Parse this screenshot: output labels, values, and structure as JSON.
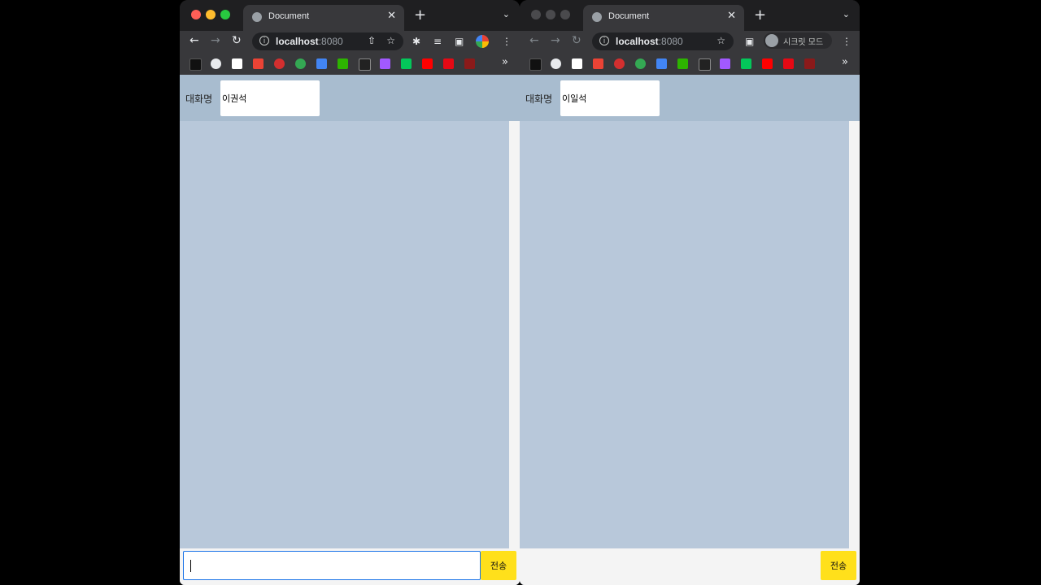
{
  "left": {
    "tab_title": "Document",
    "url_host": "localhost",
    "url_port": ":8080",
    "label": "대화명",
    "nickname": "이권석",
    "message": "",
    "send_label": "전송"
  },
  "right": {
    "tab_title": "Document",
    "url_host": "localhost",
    "url_port": ":8080",
    "incognito_label": "시크릿 모드",
    "label": "대화명",
    "nickname": "이일석",
    "message": "",
    "send_label": "전송"
  }
}
